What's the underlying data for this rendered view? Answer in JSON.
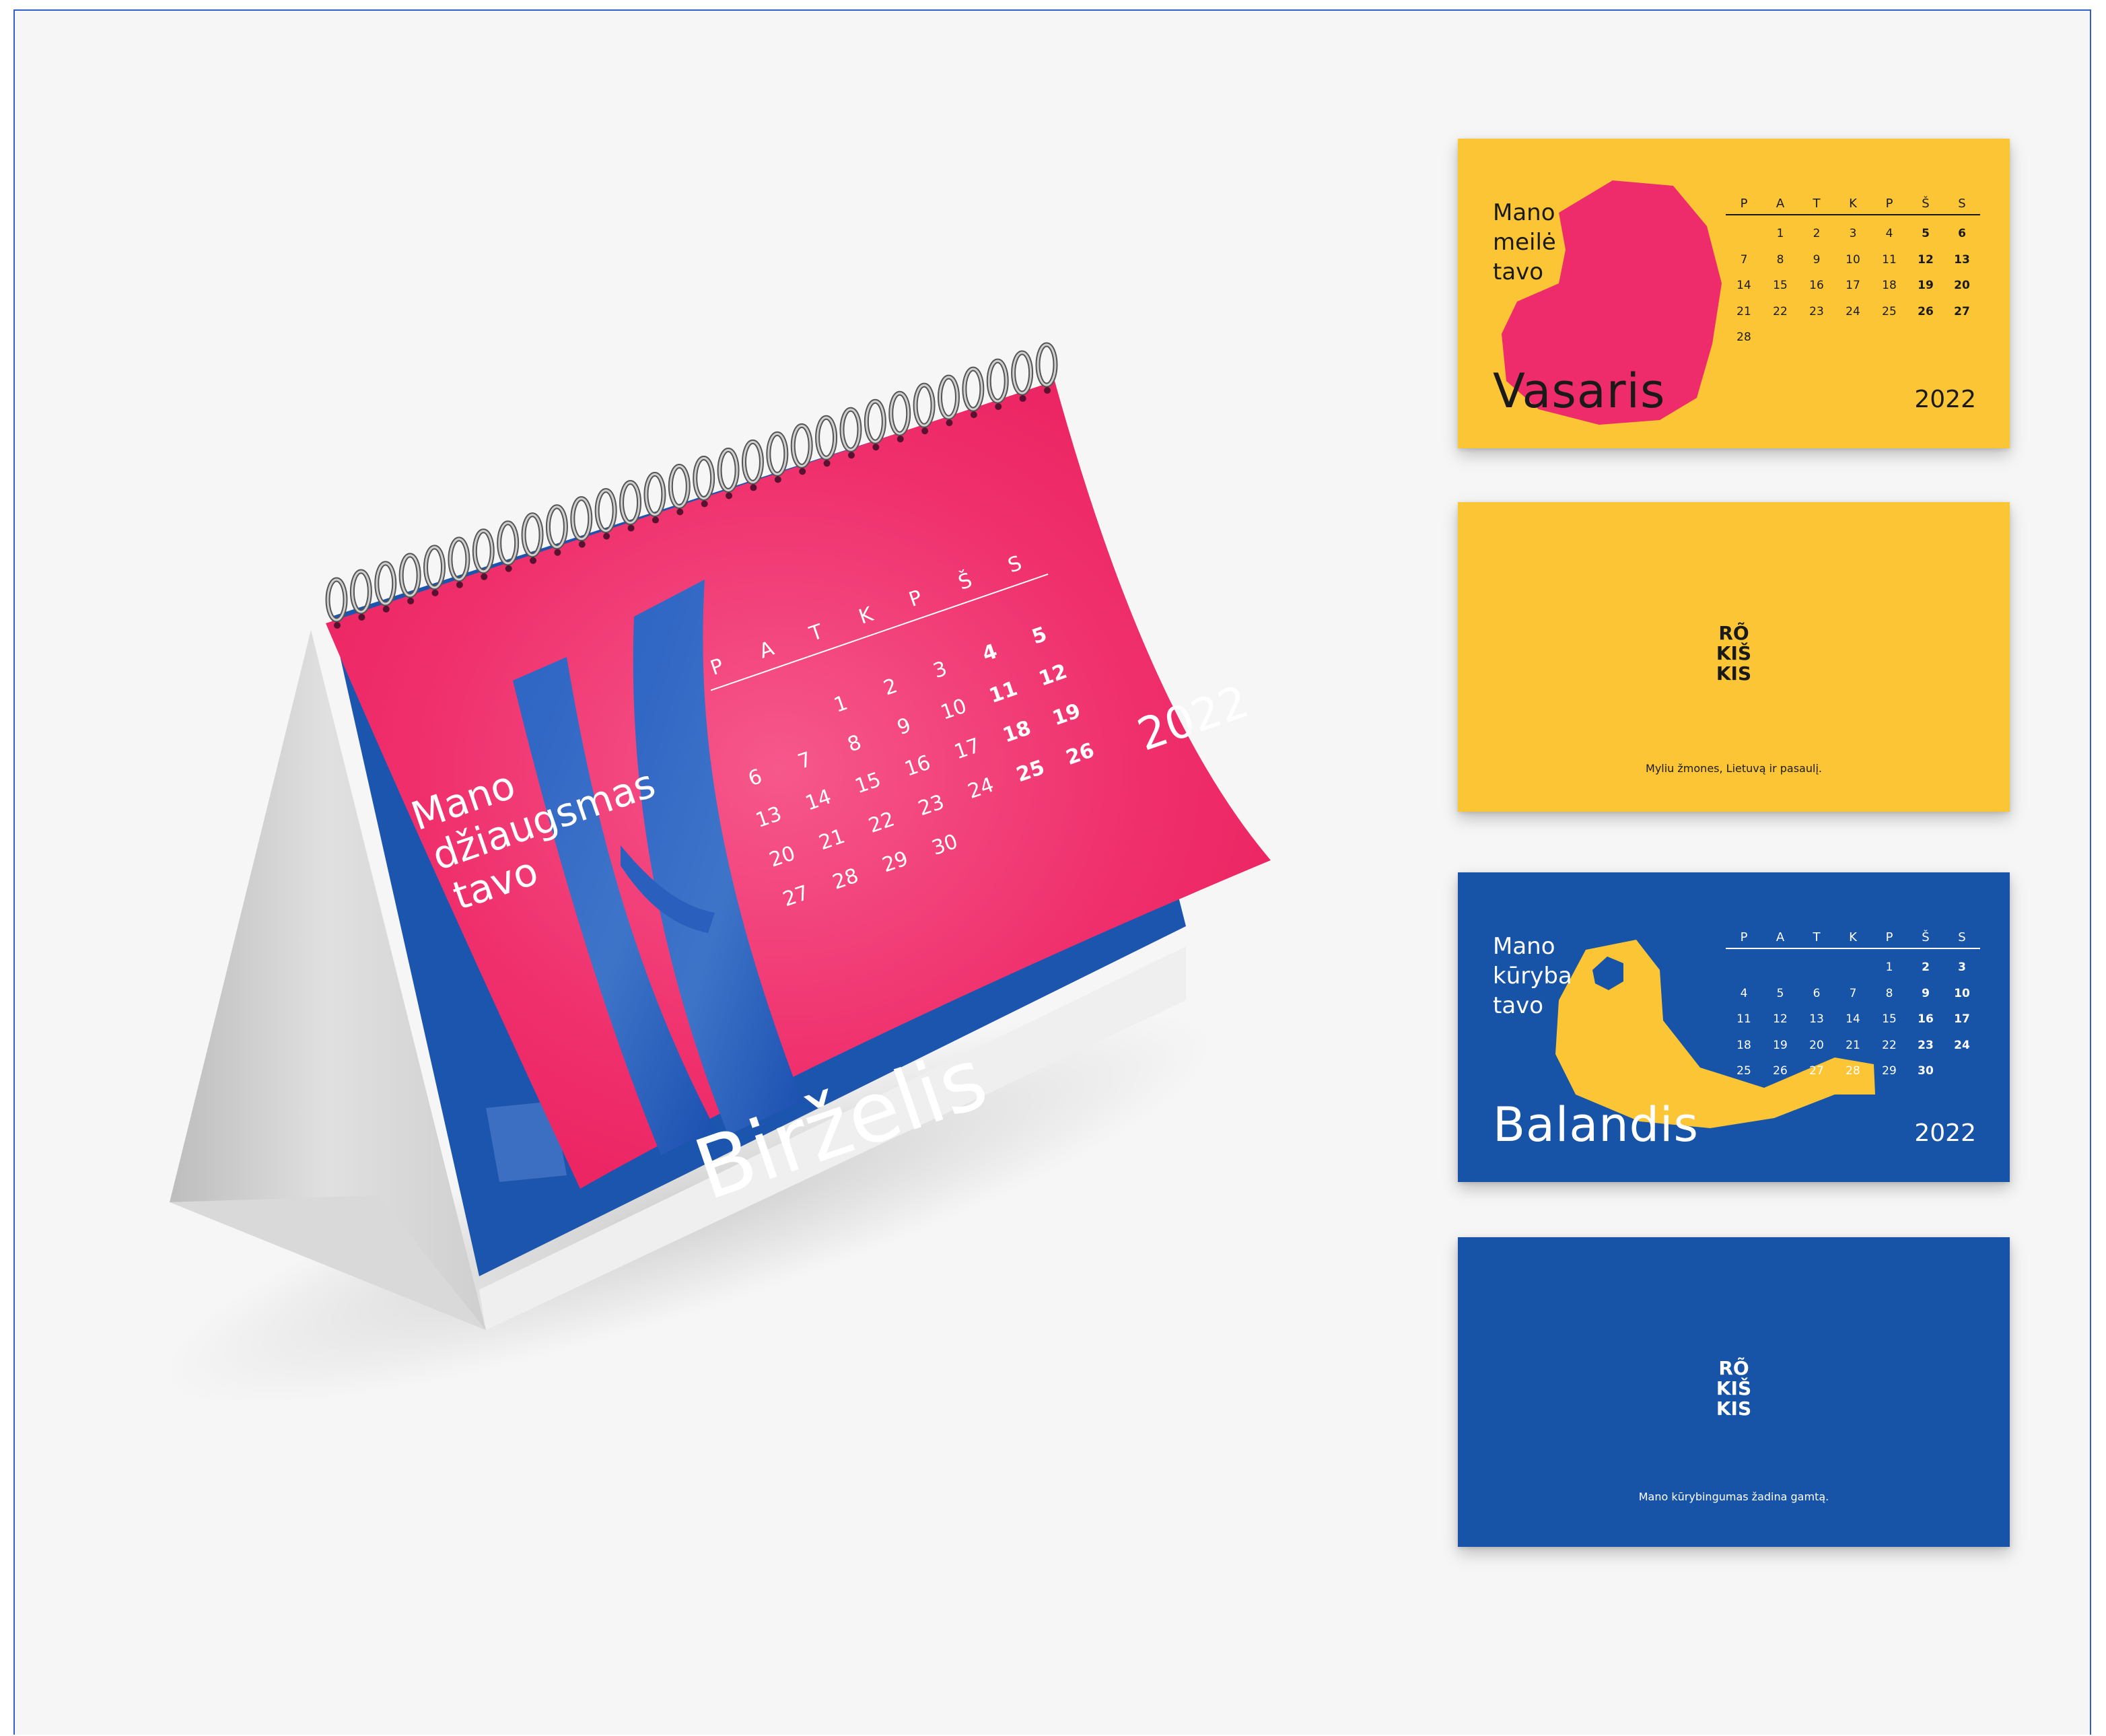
{
  "colors": {
    "background": "#f6f6f6",
    "pink": "#ef2c6b",
    "yellow": "#fbc535",
    "blue": "#1753a6",
    "frame_border": "#2f5fc8"
  },
  "weekdays": [
    "P",
    "A",
    "T",
    "K",
    "P",
    "Š",
    "S"
  ],
  "desk_calendar": {
    "tagline": [
      "Mano",
      "džiaugsmas",
      "tavo"
    ],
    "month": "Birželis",
    "year": "2022",
    "weeks": [
      [
        "",
        "",
        "1",
        "2",
        "3",
        "4",
        "5"
      ],
      [
        "6",
        "7",
        "8",
        "9",
        "10",
        "11",
        "12"
      ],
      [
        "13",
        "14",
        "15",
        "16",
        "17",
        "18",
        "19"
      ],
      [
        "20",
        "21",
        "22",
        "23",
        "24",
        "25",
        "26"
      ],
      [
        "27",
        "28",
        "29",
        "30",
        "",
        "",
        ""
      ]
    ]
  },
  "cards": [
    {
      "type": "month",
      "theme": "yellow",
      "tagline": [
        "Mano",
        "meilė",
        "tavo"
      ],
      "month": "Vasaris",
      "year": "2022",
      "illustration": "heart-shape",
      "weeks": [
        [
          "",
          "1",
          "2",
          "3",
          "4",
          "5",
          "6"
        ],
        [
          "7",
          "8",
          "9",
          "10",
          "11",
          "12",
          "13"
        ],
        [
          "14",
          "15",
          "16",
          "17",
          "18",
          "19",
          "20"
        ],
        [
          "21",
          "22",
          "23",
          "24",
          "25",
          "26",
          "27"
        ],
        [
          "28",
          "",
          "",
          "",
          "",
          "",
          ""
        ]
      ]
    },
    {
      "type": "back",
      "theme": "yellow",
      "logo": [
        "RÕ",
        "KIŠ",
        "KIS"
      ],
      "motto": "Myliu žmones, Lietuvą ir pasaulį."
    },
    {
      "type": "month",
      "theme": "blue",
      "tagline": [
        "Mano",
        "kūryba",
        "tavo"
      ],
      "month": "Balandis",
      "year": "2022",
      "illustration": "bird-shape",
      "weeks": [
        [
          "",
          "",
          "",
          "",
          "1",
          "2",
          "3"
        ],
        [
          "4",
          "5",
          "6",
          "7",
          "8",
          "9",
          "10"
        ],
        [
          "11",
          "12",
          "13",
          "14",
          "15",
          "16",
          "17"
        ],
        [
          "18",
          "19",
          "20",
          "21",
          "22",
          "23",
          "24"
        ],
        [
          "25",
          "26",
          "27",
          "28",
          "29",
          "30",
          ""
        ]
      ]
    },
    {
      "type": "back",
      "theme": "blue",
      "logo": [
        "RÕ",
        "KIŠ",
        "KIS"
      ],
      "motto": "Mano kūrybingumas žadina gamtą."
    }
  ]
}
